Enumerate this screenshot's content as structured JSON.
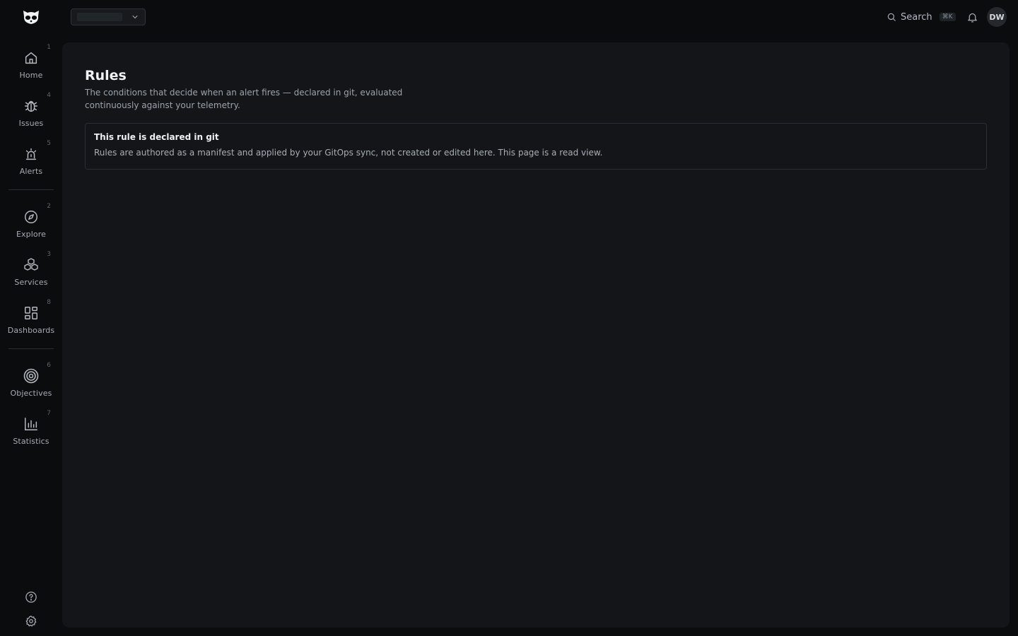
{
  "sidebar": {
    "items": [
      {
        "label": "Home",
        "shortcut": "1",
        "icon": "home-icon"
      },
      {
        "label": "Issues",
        "shortcut": "4",
        "icon": "bug-icon"
      },
      {
        "label": "Alerts",
        "shortcut": "5",
        "icon": "siren-icon"
      },
      {
        "label": "Explore",
        "shortcut": "2",
        "icon": "compass-icon"
      },
      {
        "label": "Services",
        "shortcut": "3",
        "icon": "boxes-icon"
      },
      {
        "label": "Dashboards",
        "shortcut": "8",
        "icon": "grid-icon"
      },
      {
        "label": "Objectives",
        "shortcut": "6",
        "icon": "target-icon"
      },
      {
        "label": "Statistics",
        "shortcut": "7",
        "icon": "bar-chart-icon"
      }
    ],
    "help_icon": "help-icon",
    "settings_icon": "gear-icon"
  },
  "header": {
    "search_label": "Search",
    "search_shortcut": "⌘K",
    "avatar_initials": "DW"
  },
  "main": {
    "title": "Rules",
    "description": "The conditions that decide when an alert fires — declared in git, evaluated continuously against your telemetry.",
    "notice": {
      "title": "This rule is declared in git",
      "body": "Rules are authored as a manifest and applied by your GitOps sync, not created or edited here. This page is a read view."
    }
  },
  "colors": {
    "background": "#0b0c0e",
    "panel": "#131519",
    "border": "#2b2e34"
  }
}
